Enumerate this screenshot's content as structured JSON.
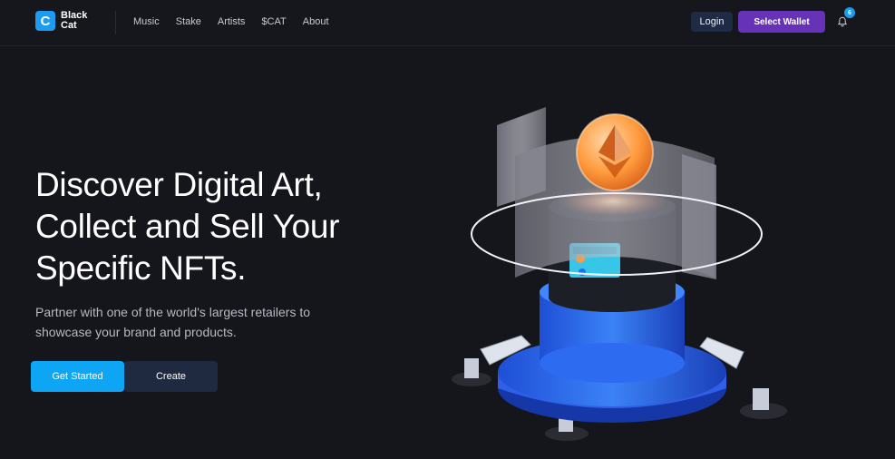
{
  "brand": {
    "logo_letter": "C",
    "name_line1": "Black",
    "name_line2": "Cat"
  },
  "nav": {
    "items": [
      "Music",
      "Stake",
      "Artists",
      "$CAT",
      "About"
    ]
  },
  "header": {
    "login": "Login",
    "wallet": "Select Wallet",
    "notification_count": "6",
    "icon": "bell-icon"
  },
  "hero": {
    "title_lines": [
      "Discover Digital Art,",
      "Collect and Sell Your",
      "Specific NFTs."
    ],
    "subtitle": "Partner with one of the world's largest retailers to showcase your brand and products.",
    "primary_button": "Get Started",
    "secondary_button": "Create"
  },
  "colors": {
    "accent": "#0ea5f5",
    "wallet": "#6532b8",
    "background": "#15151c"
  }
}
